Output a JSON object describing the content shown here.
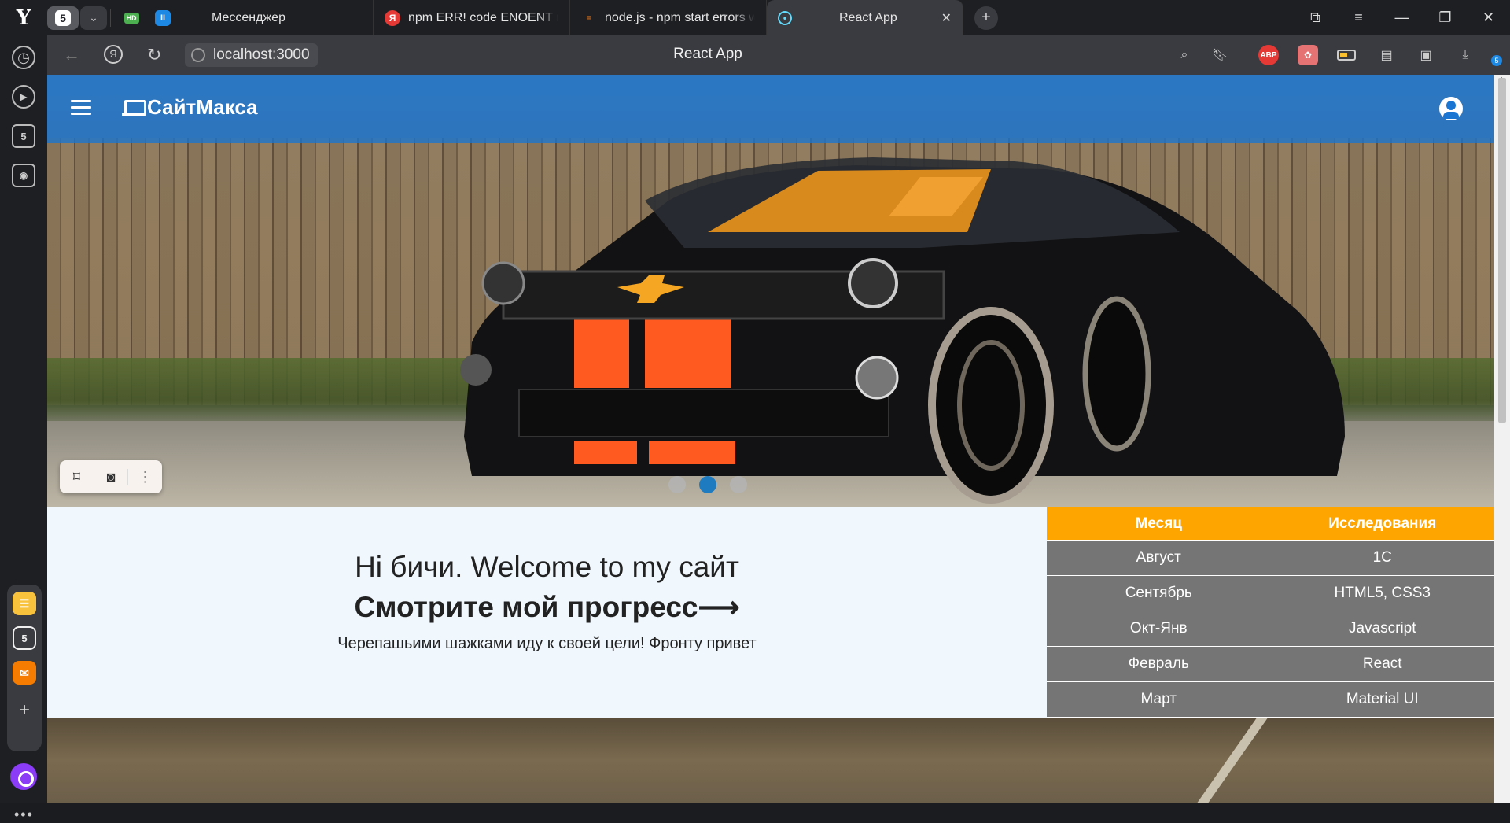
{
  "browser": {
    "logo": "Y",
    "tab_count": "5",
    "tabs": [
      {
        "title": "Мессенджер",
        "favicon": "messenger"
      },
      {
        "title": "npm ERR! code ENOENT npm",
        "favicon": "yandex",
        "icon_text": "Я"
      },
      {
        "title": "node.js - npm start errors w",
        "favicon": "stackoverflow"
      },
      {
        "title": "React App",
        "favicon": "react",
        "active": true
      }
    ],
    "url": "localhost:3000",
    "page_title": "React App",
    "extensions": {
      "abp": "ABP",
      "downloads_badge": "5"
    }
  },
  "sidebar": {
    "items": [
      "history-icon",
      "play-icon",
      "tab-count-icon",
      "screenshot-icon"
    ],
    "tab_badge": "5"
  },
  "site": {
    "brand": "СайтМакса",
    "greeting": "Hi бичи. Welcome to my сайт",
    "heading": "Смотрите мой прогресс⟶",
    "subtext": "Черепашьими шажками иду к своей цели! Фронту привет",
    "carousel": {
      "slides": 3,
      "active": 2
    },
    "table": {
      "headers": [
        "Месяц",
        "Исследования"
      ],
      "rows": [
        [
          "Август",
          "1С"
        ],
        [
          "Сентябрь",
          "HTML5, CSS3"
        ],
        [
          "Окт-Янв",
          "Javascript"
        ],
        [
          "Февраль",
          "React"
        ],
        [
          "Март",
          "Material UI"
        ]
      ]
    },
    "colors": {
      "appbar": "#1976d2",
      "table_header": "#ffa500",
      "table_row": "#757575",
      "dot_active": "#1f7bbf"
    }
  }
}
